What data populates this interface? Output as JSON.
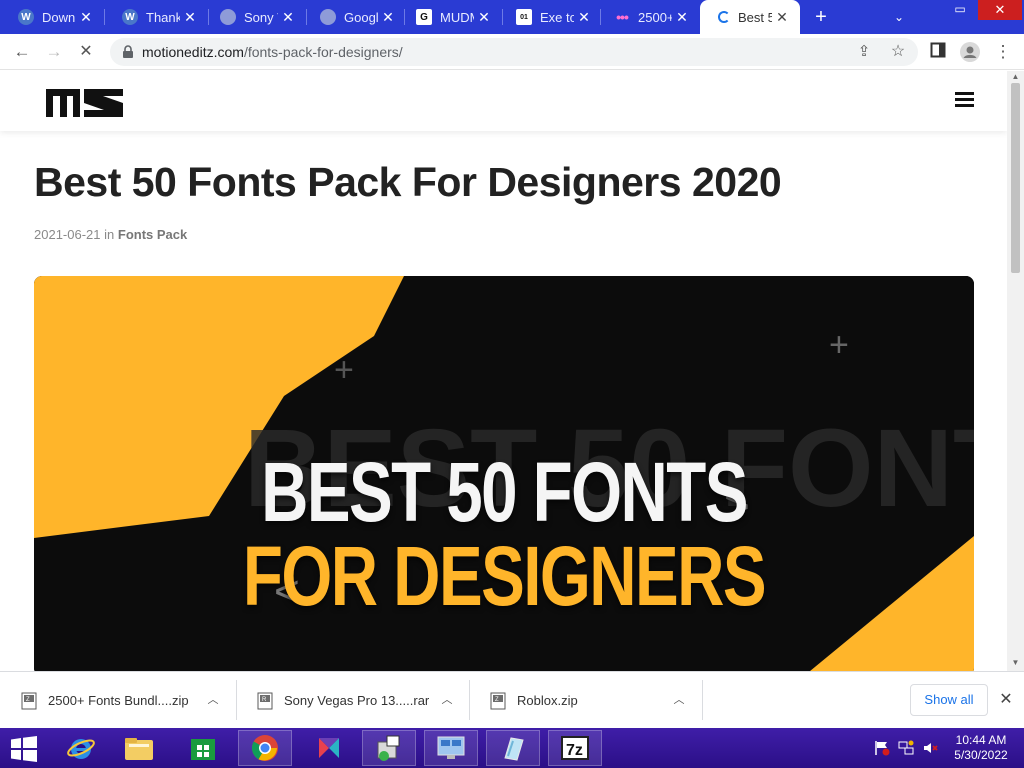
{
  "browser": {
    "tabs": [
      {
        "title": "Downl",
        "favicon": "wp-icon",
        "active": false
      },
      {
        "title": "Thank",
        "favicon": "wp-icon",
        "active": false
      },
      {
        "title": "Sony V",
        "favicon": "globe-icon",
        "active": false
      },
      {
        "title": "Googl",
        "favicon": "globe-icon",
        "active": false
      },
      {
        "title": "MUDM",
        "favicon": "g-icon",
        "active": false
      },
      {
        "title": "Exe to",
        "favicon": "exe-icon",
        "active": false
      },
      {
        "title": "2500+",
        "favicon": "dots-icon",
        "active": false
      },
      {
        "title": "Best 5",
        "favicon": "loading-icon",
        "active": true
      }
    ],
    "url_domain": "motioneditz.com",
    "url_path": "/fonts-pack-for-designers/"
  },
  "site": {
    "logo_text": "ME"
  },
  "article": {
    "title": "Best 50 Fonts Pack For Designers 2020",
    "date": "2021-06-21",
    "in_label": "in",
    "category": "Fonts Pack",
    "hero_line1": "BEST 50 FONTS",
    "hero_line2": "FOR DESIGNERS"
  },
  "downloads": {
    "items": [
      {
        "name": "2500+ Fonts Bundl....zip"
      },
      {
        "name": "Sony Vegas Pro 13.....rar"
      },
      {
        "name": "Roblox.zip"
      }
    ],
    "show_all_label": "Show all"
  },
  "taskbar": {
    "apps": [
      "internet-explorer-icon",
      "file-explorer-icon",
      "store-icon",
      "chrome-icon",
      "app-icon",
      "installer-icon",
      "remote-desktop-icon",
      "notepad-icon",
      "7zip-icon"
    ],
    "time": "10:44 AM",
    "date": "5/30/2022"
  },
  "colors": {
    "tabstrip": "#2a3bd3",
    "hero_yellow": "#ffb52a",
    "taskbar": "#3f1ea8",
    "link_blue": "#1a73e8"
  }
}
